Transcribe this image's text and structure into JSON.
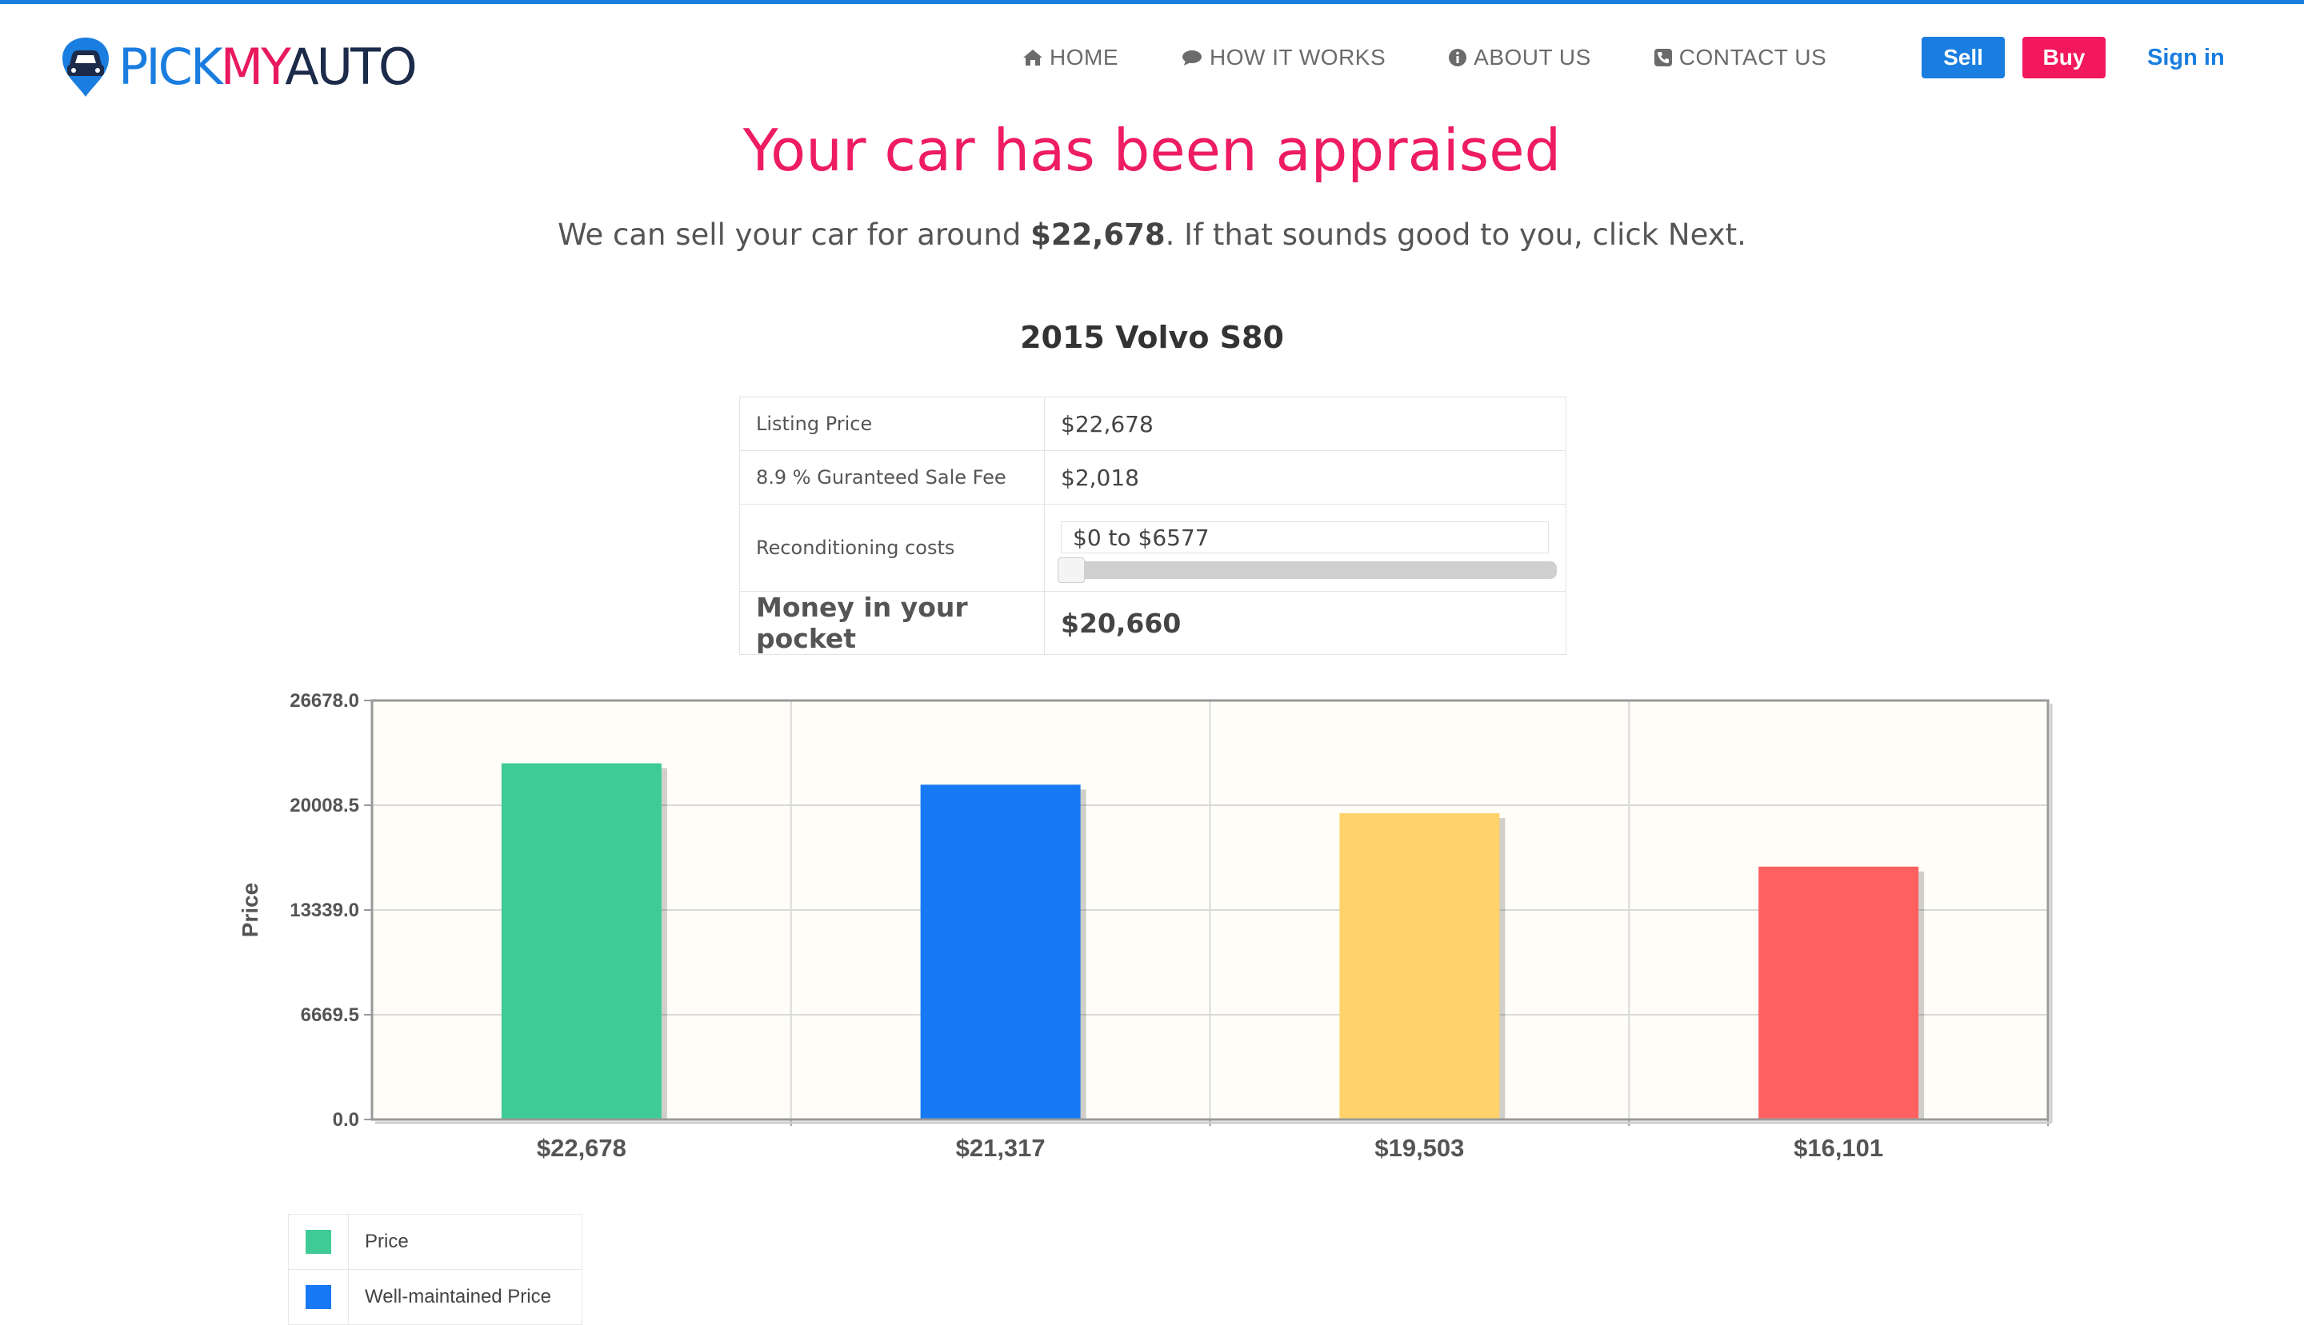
{
  "brand": {
    "logo_part1": "PICK",
    "logo_part2": "MY",
    "logo_part3": "AUTO",
    "colors": {
      "blue": "#1a7de0",
      "pink": "#e8195c",
      "navy": "#1c2b4a"
    }
  },
  "nav": {
    "items": [
      {
        "label": "HOME",
        "icon": "home-icon"
      },
      {
        "label": "HOW IT WORKS",
        "icon": "comment-icon"
      },
      {
        "label": "ABOUT US",
        "icon": "info-icon"
      },
      {
        "label": "CONTACT US",
        "icon": "phone-icon"
      }
    ],
    "sell_label": "Sell",
    "buy_label": "Buy",
    "signin_label": "Sign in"
  },
  "main": {
    "headline": "Your car has been appraised",
    "subline_prefix": "We can sell your car for around ",
    "subline_amount": "$22,678",
    "subline_suffix": ". If that sounds good to you, click Next.",
    "car_title": "2015 Volvo S80"
  },
  "pricing_table": {
    "rows": [
      {
        "label": "Listing Price",
        "value": "$22,678"
      },
      {
        "label": "8.9 % Guranteed Sale Fee",
        "value": "$2,018"
      },
      {
        "label": "Reconditioning costs",
        "value": "$0 to $6577"
      },
      {
        "label": "Money in your pocket",
        "value": "$20,660"
      }
    ],
    "reconditioning_slider_fraction": 0
  },
  "chart_data": {
    "type": "bar",
    "categories": [
      "$22,678",
      "$21,317",
      "$19,503",
      "$16,101"
    ],
    "values": [
      22678,
      21317,
      19503,
      16101
    ],
    "colors": [
      "#3ecb96",
      "#1779f3",
      "#ffd26a",
      "#ff6161"
    ],
    "ylabel": "Price",
    "yticks": [
      "0.0",
      "6669.5",
      "13339.0",
      "20008.5",
      "26678.0"
    ],
    "ylim": [
      0,
      26678
    ],
    "grid": true,
    "legend": [
      "Price",
      "Well-maintained Price"
    ]
  }
}
